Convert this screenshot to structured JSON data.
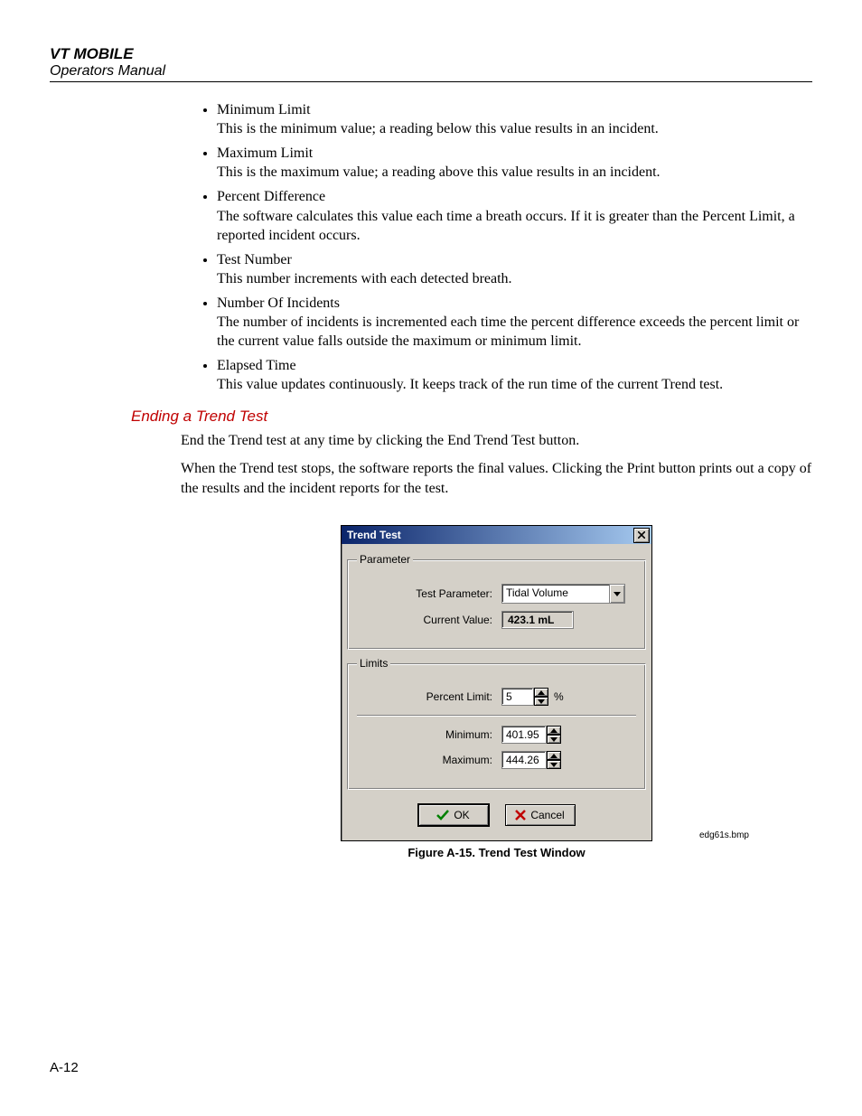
{
  "header": {
    "title": "VT MOBILE",
    "subtitle": "Operators Manual"
  },
  "bullets": [
    {
      "term": "Minimum Limit",
      "desc": "This is the minimum value; a reading below this value results in an incident."
    },
    {
      "term": "Maximum Limit",
      "desc": "This is the maximum value; a reading above this value results in an incident."
    },
    {
      "term": "Percent Difference",
      "desc": "The software calculates this value each time a breath occurs. If it is greater than the Percent Limit, a reported incident occurs."
    },
    {
      "term": "Test Number",
      "desc": "This number increments with each detected breath."
    },
    {
      "term": "Number Of Incidents",
      "desc": "The number of incidents is incremented each time the percent difference exceeds the percent limit or the current value falls outside the maximum or minimum limit."
    },
    {
      "term": "Elapsed Time",
      "desc": "This value updates continuously. It keeps track of the run time of the current Trend test."
    }
  ],
  "section": {
    "heading": "Ending a Trend Test",
    "para1": "End the Trend test at any time by clicking the End Trend Test button.",
    "para2": "When the Trend test stops, the software reports the final values. Clicking the Print button prints out a copy of the results and the incident reports for the test."
  },
  "dialog": {
    "title": "Trend Test",
    "group_parameter": "Parameter",
    "group_limits": "Limits",
    "labels": {
      "test_parameter": "Test Parameter:",
      "current_value": "Current Value:",
      "percent_limit": "Percent Limit:",
      "minimum": "Minimum:",
      "maximum": "Maximum:"
    },
    "values": {
      "test_parameter": "Tidal Volume",
      "current_value": "423.1 mL",
      "percent_limit": "5",
      "percent_unit": "%",
      "minimum": "401.95",
      "maximum": "444.26"
    },
    "buttons": {
      "ok": "OK",
      "cancel": "Cancel"
    }
  },
  "figure": {
    "caption": "Figure A-15. Trend Test Window",
    "filename": "edg61s.bmp"
  },
  "page_number": "A-12"
}
